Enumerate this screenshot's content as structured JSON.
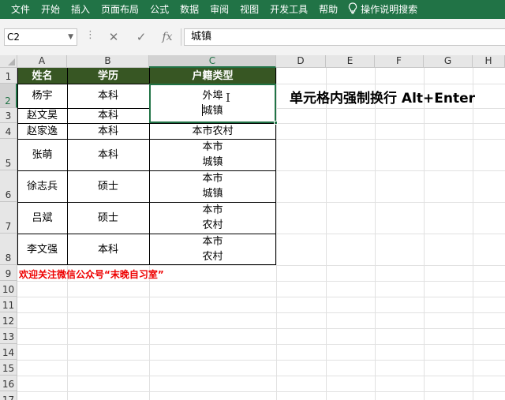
{
  "ribbon": {
    "tabs": [
      "文件",
      "开始",
      "插入",
      "页面布局",
      "公式",
      "数据",
      "审阅",
      "视图",
      "开发工具",
      "帮助"
    ],
    "tell_me": "操作说明搜索",
    "tell_me_icon": "lightbulb-icon"
  },
  "formula_bar": {
    "name_box": "C2",
    "formula": "城镇",
    "fx": "fx"
  },
  "columns": [
    "A",
    "B",
    "C",
    "D",
    "E",
    "F",
    "G",
    "H"
  ],
  "rows": [
    "1",
    "2",
    "3",
    "4",
    "5",
    "6",
    "7",
    "8",
    "9",
    "10",
    "11",
    "12",
    "13",
    "14",
    "15",
    "16",
    "17"
  ],
  "table": {
    "headers": [
      "姓名",
      "学历",
      "户籍类型"
    ],
    "rows": [
      {
        "name": "杨宇",
        "edu": "本科",
        "type": [
          "外埠",
          "城镇"
        ]
      },
      {
        "name": "赵文昊",
        "edu": "本科",
        "type": []
      },
      {
        "name": "赵家逸",
        "edu": "本科",
        "type": [
          "本市农村"
        ]
      },
      {
        "name": "张萌",
        "edu": "本科",
        "type": [
          "本市",
          "城镇"
        ]
      },
      {
        "name": "徐志兵",
        "edu": "硕士",
        "type": [
          "本市",
          "城镇"
        ]
      },
      {
        "name": "吕斌",
        "edu": "硕士",
        "type": [
          "本市",
          "农村"
        ]
      },
      {
        "name": "李文强",
        "edu": "本科",
        "type": [
          "本市",
          "农村"
        ]
      }
    ]
  },
  "note": "单元格内强制换行 Alt+Enter",
  "footer_text": "欢迎关注微信公众号“末晚自习室”",
  "colors": {
    "ribbon": "#217346",
    "header_fill": "#375623",
    "footer_text": "#e00000"
  }
}
